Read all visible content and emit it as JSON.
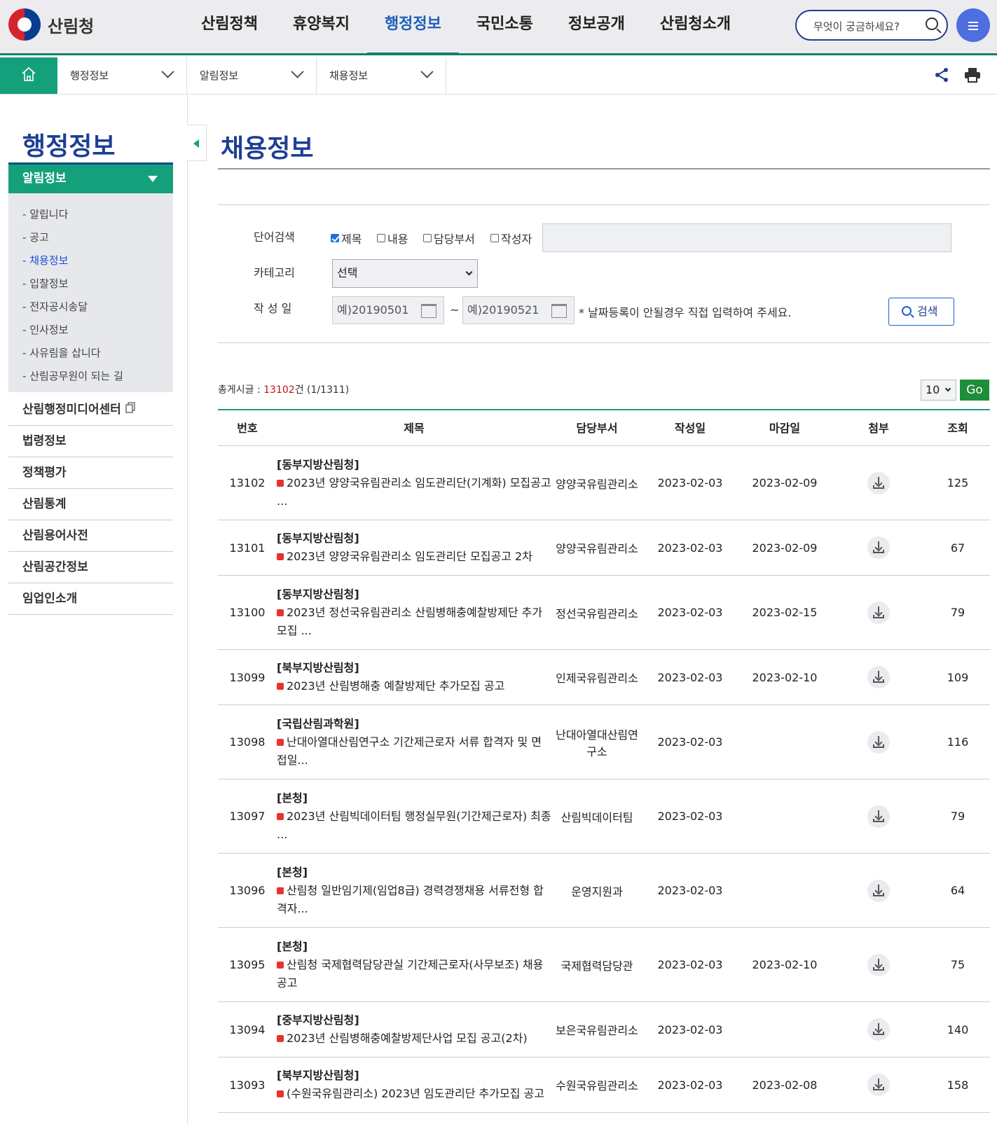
{
  "header": {
    "logo_text": "산림청",
    "nav": [
      "산림정책",
      "휴양복지",
      "행정정보",
      "국민소통",
      "정보공개",
      "산림청소개"
    ],
    "active_nav": "행정정보",
    "search_placeholder": "무엇이 궁금하세요?"
  },
  "breadcrumb": [
    "행정정보",
    "알림정보",
    "채용정보"
  ],
  "sidebar": {
    "title": "행정정보",
    "section": "알림정보",
    "sub_items": [
      "알립니다",
      "공고",
      "채용정보",
      "입찰정보",
      "전자공시송달",
      "인사정보",
      "사유림을 삽니다",
      "산림공무원이 되는 길"
    ],
    "active_sub": "채용정보",
    "main_items": [
      "산림행정미디어센터",
      "법령정보",
      "정책평가",
      "산림통계",
      "산림용어사전",
      "산림공간정보",
      "임업인소개"
    ]
  },
  "page_title": "채용정보",
  "filters": {
    "word_search_label": "단어검색",
    "checkboxes": [
      {
        "label": "제목",
        "checked": true
      },
      {
        "label": "내용",
        "checked": false
      },
      {
        "label": "담당부서",
        "checked": false
      },
      {
        "label": "작성자",
        "checked": false
      }
    ],
    "category_label": "카테고리",
    "category_value": "선택",
    "date_label": "작 성 일",
    "date_from_placeholder": "예)20190501",
    "date_sep": "~",
    "date_to_placeholder": "예)20190521",
    "date_note": "* 날짜등록이 안될경우 직접 입력하여 주세요.",
    "search_button": "검색"
  },
  "list_info": {
    "prefix": "총게시글 : ",
    "count": "13102",
    "suffix": "건 (1/1311)",
    "per_page": "10",
    "go_label": "Go"
  },
  "table": {
    "columns": [
      "번호",
      "제목",
      "담당부서",
      "작성일",
      "마감일",
      "첨부",
      "조회"
    ],
    "rows": [
      {
        "no": "13102",
        "org": "[동부지방산림청]",
        "title": "2023년 양양국유림관리소 임도관리단(기계화) 모집공고 ...",
        "dept": "양양국유림관리소",
        "date": "2023-02-03",
        "deadline": "2023-02-09",
        "views": "125"
      },
      {
        "no": "13101",
        "org": "[동부지방산림청]",
        "title": "2023년 양양국유림관리소 임도관리단 모집공고 2차",
        "dept": "양양국유림관리소",
        "date": "2023-02-03",
        "deadline": "2023-02-09",
        "views": "67"
      },
      {
        "no": "13100",
        "org": "[동부지방산림청]",
        "title": "2023년 정선국유림관리소 산림병해충예찰방제단 추가모집 ...",
        "dept": "정선국유림관리소",
        "date": "2023-02-03",
        "deadline": "2023-02-15",
        "views": "79"
      },
      {
        "no": "13099",
        "org": "[북부지방산림청]",
        "title": "2023년 산림병해충 예찰방제단 추가모집 공고",
        "dept": "인제국유림관리소",
        "date": "2023-02-03",
        "deadline": "2023-02-10",
        "views": "109"
      },
      {
        "no": "13098",
        "org": "[국립산림과학원]",
        "title": "난대아열대산림연구소 기간제근로자 서류 합격자 및 면접일...",
        "dept": "난대아열대산림연구소",
        "date": "2023-02-03",
        "deadline": "",
        "views": "116"
      },
      {
        "no": "13097",
        "org": "[본청]",
        "title": "2023년 산림빅데이터팀 행정실무원(기간제근로자) 최종 ...",
        "dept": "산림빅데이터팀",
        "date": "2023-02-03",
        "deadline": "",
        "views": "79"
      },
      {
        "no": "13096",
        "org": "[본청]",
        "title": "산림청 일반임기제(임업8급) 경력경쟁채용 서류전형 합격자...",
        "dept": "운영지원과",
        "date": "2023-02-03",
        "deadline": "",
        "views": "64"
      },
      {
        "no": "13095",
        "org": "[본청]",
        "title": "산림청 국제협력담당관실 기간제근로자(사무보조) 채용 공고",
        "dept": "국제협력담당관",
        "date": "2023-02-03",
        "deadline": "2023-02-10",
        "views": "75"
      },
      {
        "no": "13094",
        "org": "[중부지방산림청]",
        "title": "2023년 산림병해충예찰방제단사업 모집 공고(2차)",
        "dept": "보은국유림관리소",
        "date": "2023-02-03",
        "deadline": "",
        "views": "140"
      },
      {
        "no": "13093",
        "org": "[북부지방산림청]",
        "title": "(수원국유림관리소) 2023년 임도관리단 추가모집 공고",
        "dept": "수원국유림관리소",
        "date": "2023-02-03",
        "deadline": "2023-02-08",
        "views": "158"
      }
    ]
  }
}
